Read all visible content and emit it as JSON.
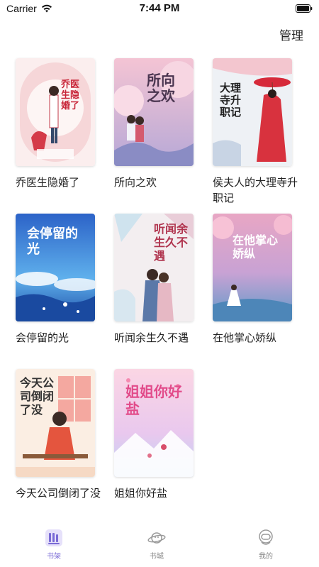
{
  "status_bar": {
    "carrier": "Carrier",
    "time": "7:44 PM"
  },
  "header": {
    "manage_label": "管理"
  },
  "books": [
    {
      "title": "乔医生隐婚了",
      "cover_text": "乔医生隐婚了"
    },
    {
      "title": "所向之欢",
      "cover_text": "所向之欢"
    },
    {
      "title": "侯夫人的大理寺升职记",
      "cover_text": "大理寺升职记"
    },
    {
      "title": "会停留的光",
      "cover_text": "会停留的光"
    },
    {
      "title": "听闻余生久不遇",
      "cover_text": "听闻余生久不遇"
    },
    {
      "title": "在他掌心娇纵",
      "cover_text": "在他掌心娇纵"
    },
    {
      "title": "今天公司倒闭了没",
      "cover_text": "今天公司倒闭了没"
    },
    {
      "title": "姐姐你好盐",
      "cover_text": "姐姐你好盐"
    }
  ],
  "tabs": [
    {
      "label": "书架",
      "icon": "bookshelf-icon",
      "active": true
    },
    {
      "label": "书城",
      "icon": "planet-icon",
      "active": false
    },
    {
      "label": "我的",
      "icon": "astronaut-icon",
      "active": false
    }
  ],
  "colors": {
    "accent": "#7a6bd6",
    "text": "#222222"
  }
}
